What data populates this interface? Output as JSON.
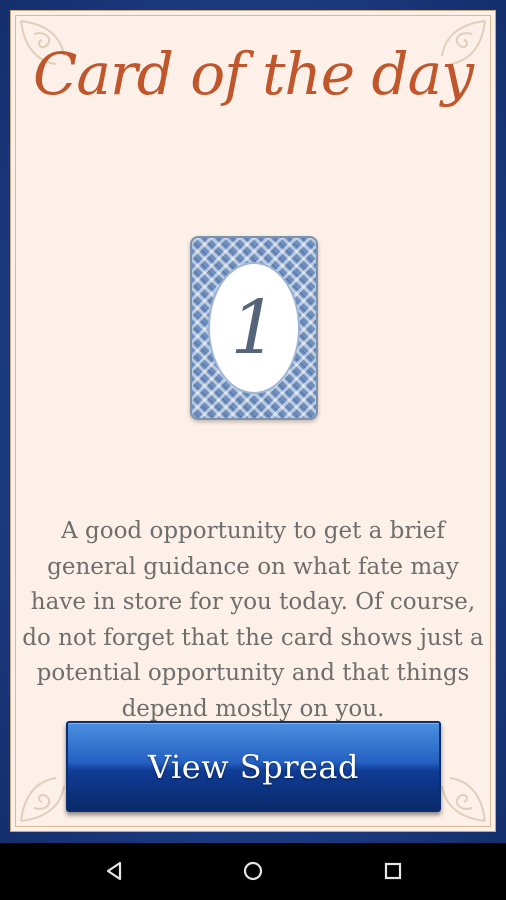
{
  "app": {
    "title": "Card of the day"
  },
  "card": {
    "number": "1"
  },
  "description": "A good opportunity to get a brief general guidance on what fate may have in store for you today. Of course, do not forget that the card shows just a potential opportunity and that things depend mostly on you.",
  "actions": {
    "view_spread_label": "View Spread"
  },
  "system_nav": {
    "icons": [
      "back-icon",
      "home-icon",
      "recent-apps-icon"
    ]
  },
  "colors": {
    "title": "#c0562b",
    "paper": "#fdf0e8",
    "frame": "#1f3f86",
    "button": "#2461c2",
    "text": "#6e6e6e"
  }
}
